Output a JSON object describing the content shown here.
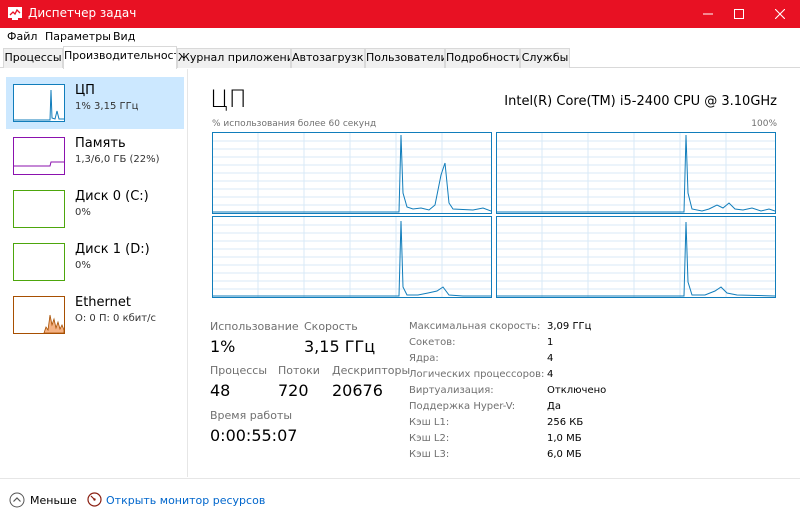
{
  "window": {
    "title": "Диспетчер задач"
  },
  "menu": [
    "Файл",
    "Параметры",
    "Вид"
  ],
  "tabs": [
    "Процессы",
    "Производительность",
    "Журнал приложений",
    "Автозагрузка",
    "Пользователи",
    "Подробности",
    "Службы"
  ],
  "active_tab": "Производительность",
  "sidebar": [
    {
      "name": "ЦП",
      "sub": "1% 3,15 ГГц",
      "color": "#117dbb",
      "selected": true
    },
    {
      "name": "Память",
      "sub": "1,3/6,0 ГБ (22%)",
      "color": "#8b12ae",
      "selected": false
    },
    {
      "name": "Диск 0 (C:)",
      "sub": "0%",
      "color": "#4da60c",
      "selected": false
    },
    {
      "name": "Диск 1 (D:)",
      "sub": "0%",
      "color": "#4da60c",
      "selected": false
    },
    {
      "name": "Ethernet",
      "sub": "О: 0 П: 0 кбит/с",
      "color": "#a74f01",
      "selected": false
    }
  ],
  "main": {
    "title": "ЦП",
    "cpu_model": "Intel(R) Core(TM) i5-2400 CPU @ 3.10GHz",
    "graph_label_left": "% использования более 60 секунд",
    "graph_label_right": "100%",
    "stats": {
      "usage_label": "Использование",
      "usage_value": "1%",
      "speed_label": "Скорость",
      "speed_value": "3,15 ГГц",
      "processes_label": "Процессы",
      "processes_value": "48",
      "threads_label": "Потоки",
      "threads_value": "720",
      "handles_label": "Дескрипторы",
      "handles_value": "20676",
      "uptime_label": "Время работы",
      "uptime_value": "0:00:55:07"
    },
    "info": [
      {
        "label": "Максимальная скорость:",
        "value": "3,09 ГГц"
      },
      {
        "label": "Сокетов:",
        "value": "1"
      },
      {
        "label": "Ядра:",
        "value": "4"
      },
      {
        "label": "Логических процессоров:",
        "value": "4"
      },
      {
        "label": "Виртуализация:",
        "value": "Отключено"
      },
      {
        "label": "Поддержка Hyper-V:",
        "value": "Да"
      },
      {
        "label": "Кэш L1:",
        "value": "256 КБ"
      },
      {
        "label": "Кэш L2:",
        "value": "1,0 МБ"
      },
      {
        "label": "Кэш L3:",
        "value": "6,0 МБ"
      }
    ]
  },
  "footer": {
    "less_label": "Меньше",
    "monitor_label": "Открыть монитор ресурсов"
  },
  "icons": {
    "app": "task-manager-icon",
    "minimize": "minimize-icon",
    "maximize": "maximize-icon",
    "close": "close-icon",
    "less": "chevron-up-icon",
    "monitor": "resource-monitor-icon"
  },
  "colors": {
    "titlebar": "#e81123",
    "cpu": "#117dbb",
    "memory": "#8b12ae",
    "disk": "#4da60c",
    "ethernet": "#a74f01",
    "selected": "#cce8ff",
    "link": "#0066cc"
  }
}
